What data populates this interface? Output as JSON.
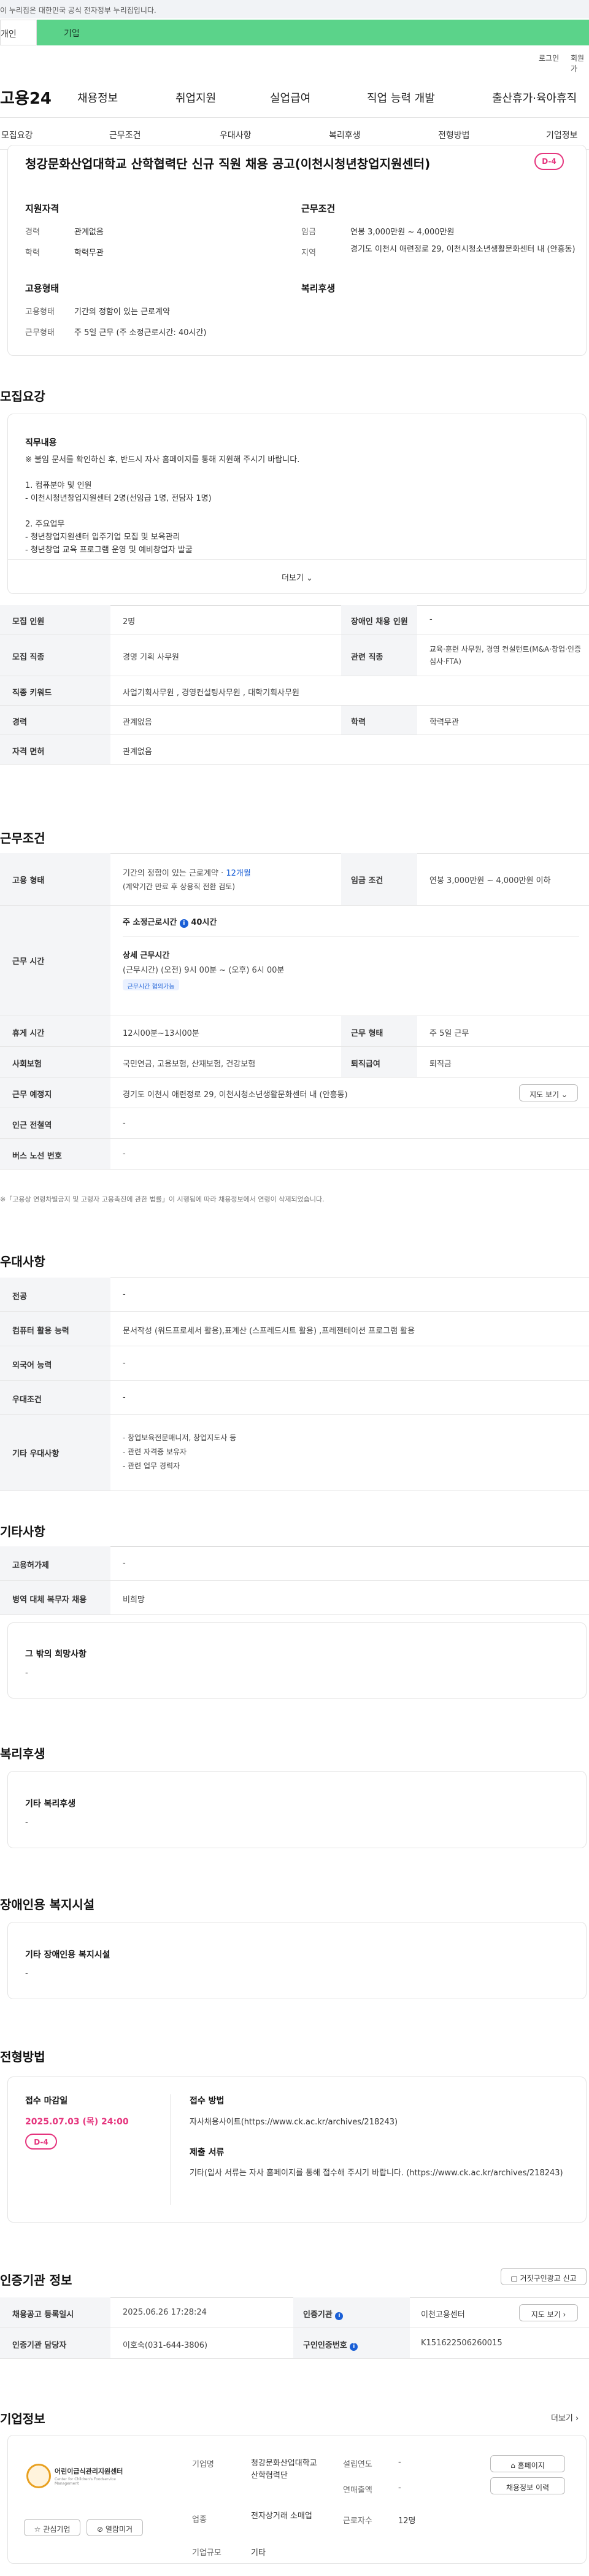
{
  "gov_banner": "이 누리집은 대한민국 공식 전자정부 누리집입니다.",
  "tabs": [
    "개인",
    "기업"
  ],
  "util": {
    "login": "로그인",
    "join": "회원가"
  },
  "gnb": {
    "logo": "고용24",
    "menu": [
      "채용정보",
      "취업지원",
      "실업급여",
      "직업 능력 개발",
      "출산휴가·육아휴직"
    ]
  },
  "snb": [
    "모집요강",
    "근무조건",
    "우대사항",
    "복리후생",
    "전형방법",
    "기업정보"
  ],
  "summary": {
    "title": "청강문화산업대학교 산학협력단 신규 직원 채용 공고(이천시청년창업지원센터)",
    "dday": "D-4",
    "qual_h": "지원자격",
    "career_l": "경력",
    "career_v": "관계없음",
    "edu_l": "학력",
    "edu_v": "학력무관",
    "emp_h": "고용형태",
    "emptype_l": "고용형태",
    "emptype_v": "기간의 정함이 있는 근로계약",
    "worktype_l": "근무형태",
    "worktype_v": "주 5일 근무 (주 소정근로시간: 40시간)",
    "cond_h": "근무조건",
    "pay_l": "임금",
    "pay_v": "연봉 3,000만원 ~ 4,000만원",
    "area_l": "지역",
    "area_v": "경기도 이천시 애련정로 29, 이천시청소년생활문화센터 내 (안흥동)",
    "welfare_h": "복리후생"
  },
  "recruit": {
    "title": "모집요강",
    "duty_h": "직무내용",
    "duty_text": "※ 불임 문서를 확인하신 후, 반드시 자사 홈페이지를 통해 지원해 주시기 바랍니다.\n\n1. 컴퓨분야 및 인원\n - 이천시청년창업지원센터 2명(선임급 1명, 전담자 1명)\n\n2. 주요업무\n - 청년창업지원센터 입주기업 모집 및 보육관리\n - 청년창업 교육 프로그램 운영 및 예비창업자 발굴\n - 청년창업기업 사업화 및 투자유치, 네트워킹 지원",
    "more": "더보기",
    "rows": [
      {
        "h1": "모집 인원",
        "v1": "2명",
        "h2": "장애인 채용 인원",
        "v2": "-"
      },
      {
        "h1": "모집 직종",
        "v1": "경영 기획 사무원",
        "h2": "관련 직종",
        "v2": "교육·훈련 사무원, 경영 컨설턴트(M&A·창업·인증심사·FTA)"
      },
      {
        "h1": "직종 키워드",
        "v1": "사업기획사무원 , 경영컨설팅사무원 , 대학기획사무원",
        "h2": "",
        "v2": ""
      },
      {
        "h1": "경력",
        "v1": "관계없음",
        "h2": "학력",
        "v2": "학력무관"
      },
      {
        "h1": "자격 면허",
        "v1": "관계없음",
        "h2": "",
        "v2": ""
      }
    ]
  },
  "work": {
    "title": "근무조건",
    "emptype_h": "고용 형태",
    "emptype_v1": "기간의 정함이 있는 근로계약 · ",
    "emptype_months": "12개월",
    "emptype_v2": "(계약기간 만료 후 상용직 전환 검토)",
    "pay_h": "임금 조건",
    "pay_v": "연봉 3,000만원 ~ 4,000만원 이하",
    "hours_h": "근무 시간",
    "hours_std": "주 소정근로시간",
    "hours_std_v": "40시간",
    "hours_detail_h": "상세 근무시간",
    "hours_detail_v": "(근무시간) (오전) 9시 00분 ~ (오후) 6시 00분",
    "hours_chip": "근무시간 협의가능",
    "rest_h": "휴게 시간",
    "rest_v": "12시00분~13시00분",
    "shift_h": "근무 형태",
    "shift_v": "주 5일 근무",
    "ins_h": "사회보험",
    "ins_v": "국민연금, 고용보험, 산재보험, 건강보험",
    "sev_h": "퇴직급여",
    "sev_v": "퇴직금",
    "loc_h": "근무 예정지",
    "loc_v": "경기도 이천시 애련정로 29, 이천시청소년생활문화센터 내 (안흥동)",
    "map_btn": "지도 보기",
    "subway_h": "인근 전철역",
    "subway_v": "-",
    "bus_h": "버스 노선 번호",
    "bus_v": "-",
    "note": "※「고용상 연령차별금지 및 고령자 고용촉진에 관한 법률」이 시행됨에 따라 채용정보에서 연령이 삭제되었습니다."
  },
  "pref": {
    "title": "우대사항",
    "rows": [
      {
        "h": "전공",
        "v": "-"
      },
      {
        "h": "컴퓨터 활용 능력",
        "v": "문서작성 (워드프로세서 활용),표계산 (스프레드시트 활용) ,프레젠테이션 프로그램 활용"
      },
      {
        "h": "외국어 능력",
        "v": "-"
      },
      {
        "h": "우대조건",
        "v": "-"
      }
    ],
    "etc_h": "기타 우대사항",
    "etc_v": "- 창업보육전문매니저, 창업지도사 등\n- 관련 자격증 보유자\n- 관련 업무 경력자"
  },
  "other": {
    "title": "기타사항",
    "rows": [
      {
        "h": "고용허가제",
        "v": "-"
      },
      {
        "h": "병역 대체 복무자 채용",
        "v": "비희망"
      }
    ],
    "extra_h": "그 밖의 희망사항",
    "extra_v": "-"
  },
  "welfare": {
    "title": "복리후생",
    "box_h": "기타 복리후생",
    "box_v": "-"
  },
  "disabled": {
    "title": "장애인용 복지시설",
    "box_h": "기타 장애인용 복지시설",
    "box_v": "-"
  },
  "process": {
    "title": "전형방법",
    "deadline_h": "접수 마감일",
    "deadline_v": "2025.07.03 (목) 24:00",
    "dday": "D-4",
    "method_h": "접수 방법",
    "method_v": "자사채용사이트(https://www.ck.ac.kr/archives/218243)",
    "docs_h": "제출 서류",
    "docs_v": "기타(입사 서류는 자사 홈페이지를 통해 접수해 주시기 바랍니다. (https://www.ck.ac.kr/archives/218243)"
  },
  "agency": {
    "title": "인증기관 정보",
    "report_btn": "거짓구인광고 신고",
    "reg_h": "채용공고 등록일시",
    "reg_v": "2025.06.26 17:28:24",
    "org_h": "인증기관",
    "org_v": "이천고용센터",
    "map_btn": "지도 보기",
    "mgr_h": "인증기관 담당자",
    "mgr_v": "이호숙(031-644-3806)",
    "id_h": "구인인증번호",
    "id_v": "K151622506260015"
  },
  "company": {
    "title": "기업정보",
    "more": "더보기",
    "logo_name": "어린이급식관리지원센터",
    "logo_sub": "Center for Children's Foodservice Management",
    "fav_btn": "관심기업",
    "block_btn": "열람미거",
    "name_h": "기업명",
    "name_v": "청강문화산업대학교 산학협력단",
    "est_h": "설립연도",
    "est_v": "-",
    "sales_h": "연매출액",
    "sales_v": "-",
    "ind_h": "업종",
    "ind_v": "전자상거래 소매업",
    "emp_h": "근로자수",
    "emp_v": "12명",
    "scale_h": "기업규모",
    "scale_v": "기타",
    "home_btn": "홈페이지",
    "history_btn": "채용정보 이력"
  }
}
